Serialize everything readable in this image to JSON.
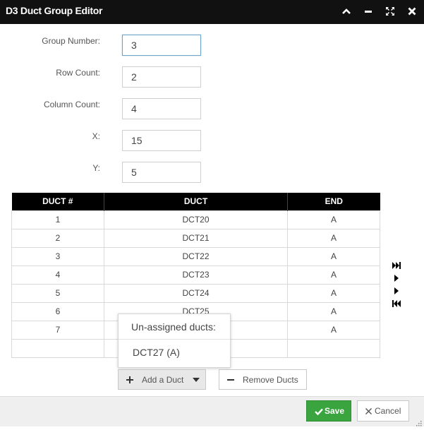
{
  "window": {
    "title": "D3 Duct Group Editor",
    "icons": [
      "chevron-up-icon",
      "minimize-icon",
      "maximize-icon",
      "close-icon"
    ]
  },
  "form": {
    "group_number": {
      "label": "Group Number:",
      "value": "3"
    },
    "row_count": {
      "label": "Row Count:",
      "value": "2"
    },
    "column_count": {
      "label": "Column Count:",
      "value": "4"
    },
    "x": {
      "label": "X:",
      "value": "15"
    },
    "y": {
      "label": "Y:",
      "value": "5"
    }
  },
  "table": {
    "headers": [
      "DUCT #",
      "DUCT",
      "END"
    ],
    "rows": [
      [
        "1",
        "DCT20",
        "A"
      ],
      [
        "2",
        "DCT21",
        "A"
      ],
      [
        "3",
        "DCT22",
        "A"
      ],
      [
        "4",
        "DCT23",
        "A"
      ],
      [
        "5",
        "DCT24",
        "A"
      ],
      [
        "6",
        "DCT25",
        "A"
      ],
      [
        "7",
        "",
        "A"
      ],
      [
        "",
        "",
        ""
      ]
    ]
  },
  "pager": {
    "icons": [
      "last-page-icon",
      "next-icon",
      "next-icon",
      "first-page-icon"
    ]
  },
  "dropdown": {
    "header": "Un-assigned ducts:",
    "items": [
      "DCT27 (A)"
    ]
  },
  "buttons": {
    "add_duct": "Add a Duct",
    "remove_ducts": "Remove Ducts",
    "save": "Save",
    "cancel": "Cancel"
  },
  "colors": {
    "titlebar": "#111111",
    "header": "#000000",
    "save": "#3aa53f",
    "focus_border": "#6fa3c8"
  }
}
